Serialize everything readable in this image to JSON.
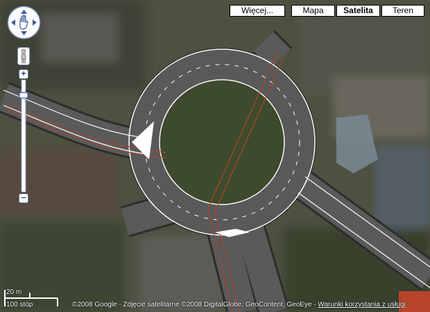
{
  "map_type_buttons": {
    "more": "Więcej...",
    "map": "Mapa",
    "satellite": "Satelita",
    "terrain": "Teren"
  },
  "selected_map_type": "Satelita",
  "zoom_controls": {
    "zoom_in": "+",
    "zoom_out": "−"
  },
  "zoom_level_fraction": 0.88,
  "scale": {
    "metric": "20 m",
    "imperial": "100 stóp"
  },
  "attribution": {
    "text": "©2008 Google - Zdjęcie satelitarne ©2008 DigitalGlobe, GeoContent, GeoEye - ",
    "terms_link": "Warunki korzystania z usługi"
  },
  "colors": {
    "road": "#575757",
    "road_edge": "#2a2a2a",
    "lane_marking": "#ffffff",
    "tram_track": "#a0482f",
    "vegetation": "#3f4a2c",
    "control_blue": "#3c5c9c"
  },
  "icons": [
    "pan-up-icon",
    "pan-down-icon",
    "pan-left-icon",
    "pan-right-icon",
    "hand-icon",
    "pegman-icon"
  ]
}
